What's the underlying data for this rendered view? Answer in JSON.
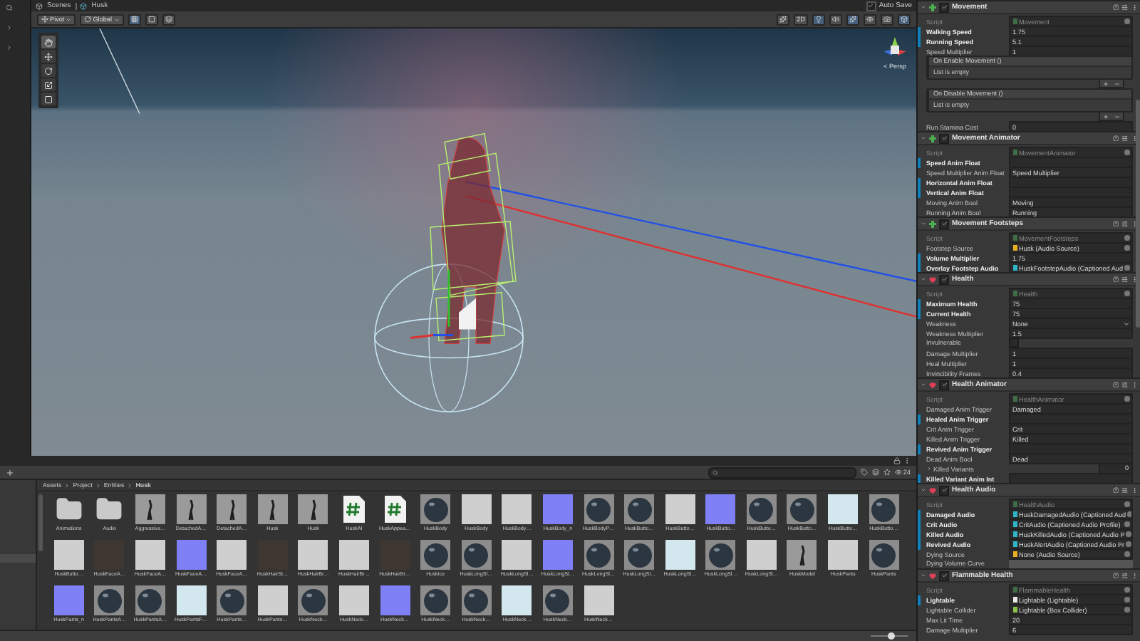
{
  "scene_header": {
    "breadcrumb": [
      "Scenes",
      "Husk"
    ],
    "auto_save": {
      "label": "Auto Save",
      "checked": true
    }
  },
  "scene_toolbar": {
    "pivot": "Pivot",
    "space": "Global",
    "mode_2d": {
      "label": "2D",
      "selected": false
    }
  },
  "scene": {
    "camera_label": "< Persp"
  },
  "project": {
    "breadcrumb": [
      "Assets",
      "Project",
      "Entities",
      "Husk"
    ],
    "hidden_count": "24",
    "zoom": {
      "level": 0.55
    },
    "assets": [
      {
        "kind": "folder",
        "label": "Animations"
      },
      {
        "kind": "folder",
        "label": "Audio"
      },
      {
        "kind": "mesh",
        "label": "Aggressive…"
      },
      {
        "kind": "mesh",
        "label": "DetachedA…"
      },
      {
        "kind": "mesh",
        "label": "DetachedA…"
      },
      {
        "kind": "mesh",
        "label": "Husk"
      },
      {
        "kind": "mesh",
        "label": "Husk"
      },
      {
        "kind": "script",
        "label": "HuskAI"
      },
      {
        "kind": "script",
        "label": "HuskAppea…"
      },
      {
        "kind": "material",
        "label": "HuskBody"
      },
      {
        "kind": "texture",
        "label": "HuskBody"
      },
      {
        "kind": "texture",
        "label": "HuskBody…"
      },
      {
        "kind": "normalmap",
        "label": "HuskBody_n"
      },
      {
        "kind": "material",
        "label": "HuskBodyP…"
      },
      {
        "kind": "material",
        "label": "HuskButto…"
      },
      {
        "kind": "texture",
        "label": "HuskButto…"
      },
      {
        "kind": "normalmap",
        "label": "HuskButto…"
      },
      {
        "kind": "material",
        "label": "HuskButto…"
      },
      {
        "kind": "material",
        "label": "HuskButto…"
      },
      {
        "kind": "icemap",
        "label": "HuskButto…"
      },
      {
        "kind": "material",
        "label": "HuskButto…"
      },
      {
        "kind": "texture",
        "label": "HuskButto…"
      },
      {
        "kind": "darkmap",
        "label": "HuskFaceA…"
      },
      {
        "kind": "texture",
        "label": "HuskFaceA…"
      },
      {
        "kind": "normalmap",
        "label": "HuskFaceA…"
      },
      {
        "kind": "texture",
        "label": "HuskFaceA…"
      },
      {
        "kind": "darkmap",
        "label": "HuskHairSt…"
      },
      {
        "kind": "texture",
        "label": "HuskHairBr…"
      },
      {
        "kind": "texture",
        "label": "HuskHairBr…"
      },
      {
        "kind": "darkmap",
        "label": "HuskHairBr…"
      },
      {
        "kind": "material",
        "label": "HuskIce"
      },
      {
        "kind": "material",
        "label": "HuskLongSl…"
      },
      {
        "kind": "texture",
        "label": "HuskLongSl…"
      },
      {
        "kind": "normalmap",
        "label": "HuskLongSl…"
      },
      {
        "kind": "material",
        "label": "HuskLongSl…"
      },
      {
        "kind": "material",
        "label": "HuskLongSl…"
      },
      {
        "kind": "icemap",
        "label": "HuskLongSl…"
      },
      {
        "kind": "material",
        "label": "HuskLongSl…"
      },
      {
        "kind": "texture",
        "label": "HuskLongSl…"
      },
      {
        "kind": "mesh",
        "label": "HuskModel"
      },
      {
        "kind": "texture",
        "label": "HuskPants"
      },
      {
        "kind": "material",
        "label": "HuskPants"
      },
      {
        "kind": "normalmap",
        "label": "HuskPants_n"
      },
      {
        "kind": "material",
        "label": "HuskPantsA…"
      },
      {
        "kind": "material",
        "label": "HuskPantsA…"
      },
      {
        "kind": "icemap",
        "label": "HuskPantsF…"
      },
      {
        "kind": "material",
        "label": "HuskPants…"
      },
      {
        "kind": "texture",
        "label": "HuskPants…"
      },
      {
        "kind": "material",
        "label": "HuskNeck…"
      },
      {
        "kind": "texture",
        "label": "HuskNeck…"
      },
      {
        "kind": "normalmap",
        "label": "HuskNeck…"
      },
      {
        "kind": "material",
        "label": "HuskNeck…"
      },
      {
        "kind": "material",
        "label": "HuskNeck…"
      },
      {
        "kind": "icemap",
        "label": "HuskNeck…"
      },
      {
        "kind": "material",
        "label": "HuskNeck…"
      },
      {
        "kind": "texture",
        "label": "HuskNeck…"
      }
    ]
  },
  "inspector": {
    "components": [
      {
        "name": "Movement",
        "color": "#4caf50",
        "enabled": true,
        "fields": [
          {
            "kind": "script",
            "label": "Script",
            "value": "Movement",
            "overridden": false
          },
          {
            "kind": "value",
            "label": "Walking Speed",
            "value": "1.75",
            "overridden": true
          },
          {
            "kind": "value",
            "label": "Running Speed",
            "value": "5.1",
            "overridden": true
          },
          {
            "kind": "value",
            "label": "Speed Multiplier",
            "value": "1",
            "overridden": false
          },
          {
            "kind": "event",
            "label": "On Enable Movement ()",
            "empty_text": "List is empty",
            "overridden": false
          },
          {
            "kind": "event",
            "label": "On Disable Movement ()",
            "empty_text": "List is empty",
            "overridden": false
          },
          {
            "kind": "value",
            "label": "Run Stamina Cost",
            "value": "0",
            "overridden": false
          }
        ]
      },
      {
        "name": "Movement Animator",
        "color": "#4caf50",
        "enabled": true,
        "fields": [
          {
            "kind": "script",
            "label": "Script",
            "value": "MovementAnimator",
            "overridden": false
          },
          {
            "kind": "value",
            "label": "Speed Anim Float",
            "overridden": true
          },
          {
            "kind": "value",
            "label": "Speed Multiplier Anim Float",
            "value": "Speed Multiplier",
            "overridden": false
          },
          {
            "kind": "value",
            "label": "Horizontal Anim Float",
            "overridden": true
          },
          {
            "kind": "value",
            "label": "Vertical Anim Float",
            "overridden": true
          },
          {
            "kind": "value",
            "label": "Moving Anim Bool",
            "value": "Moving",
            "overridden": false
          },
          {
            "kind": "value",
            "label": "Running Anim Bool",
            "value": "Running",
            "overridden": false
          }
        ]
      },
      {
        "name": "Movement Footsteps",
        "color": "#4caf50",
        "enabled": true,
        "fields": [
          {
            "kind": "script",
            "label": "Script",
            "value": "MovementFootsteps",
            "overridden": false
          },
          {
            "kind": "object",
            "label": "Footstep Source",
            "value": "Husk (Audio Source)",
            "color": "#e8b020",
            "overridden": false
          },
          {
            "kind": "value",
            "label": "Volume Multiplier",
            "value": "1.75",
            "overridden": true
          },
          {
            "kind": "object",
            "label": "Overlay Footstep Audio",
            "value": "HuskFootstepAudio (Captioned Aud",
            "color": "#2fb5c8",
            "overridden": true
          }
        ]
      },
      {
        "name": "Health",
        "color": "#e0405a",
        "enabled": true,
        "fields": [
          {
            "kind": "script",
            "label": "Script",
            "value": "Health",
            "overridden": false
          },
          {
            "kind": "value",
            "label": "Maximum Health",
            "value": "75",
            "overridden": true
          },
          {
            "kind": "value",
            "label": "Current Health",
            "value": "75",
            "overridden": true
          },
          {
            "kind": "dropdown",
            "label": "Weakness",
            "value": "None",
            "overridden": false
          },
          {
            "kind": "value",
            "label": "Weakness Multiplier",
            "value": "1.5",
            "overridden": false
          },
          {
            "kind": "checkbox",
            "label": "Invulnerable",
            "checked": false,
            "overridden": false
          },
          {
            "kind": "value",
            "label": "Damage Multiplier",
            "value": "1",
            "overridden": false
          },
          {
            "kind": "value",
            "label": "Heal Multiplier",
            "value": "1",
            "overridden": false
          },
          {
            "kind": "value",
            "label": "Invincibility Frames",
            "value": "0.4",
            "overridden": false
          }
        ]
      },
      {
        "name": "Health Animator",
        "color": "#e0405a",
        "enabled": true,
        "fields": [
          {
            "kind": "script",
            "label": "Script",
            "value": "HealthAnimator",
            "overridden": false
          },
          {
            "kind": "value",
            "label": "Damaged Anim Trigger",
            "value": "Damaged",
            "overridden": false
          },
          {
            "kind": "value",
            "label": "Healed Anim Trigger",
            "overridden": true
          },
          {
            "kind": "value",
            "label": "Crit Anim Trigger",
            "value": "Crit",
            "overridden": false
          },
          {
            "kind": "value",
            "label": "Killed Anim Trigger",
            "value": "Killed",
            "overridden": false
          },
          {
            "kind": "value",
            "label": "Revived Anim Trigger",
            "overridden": true
          },
          {
            "kind": "value",
            "label": "Dead Anim Bool",
            "value": "Dead",
            "overridden": false
          },
          {
            "kind": "foldout",
            "label": "Killed Variants",
            "value": "0",
            "expanded": false,
            "overridden": false
          },
          {
            "kind": "value",
            "label": "Killed Variant Anim Int",
            "overridden": true
          }
        ]
      },
      {
        "name": "Health Audio",
        "color": "#e0405a",
        "enabled": true,
        "fields": [
          {
            "kind": "script",
            "label": "Script",
            "value": "HealthAudio",
            "overridden": false
          },
          {
            "kind": "object",
            "label": "Damaged Audio",
            "value": "HuskDamagedAudio (Captioned Aud",
            "color": "#2fb5c8",
            "overridden": true
          },
          {
            "kind": "object",
            "label": "Crit Audio",
            "value": "CritAudio (Captioned Audio Profile)",
            "color": "#2fb5c8",
            "overridden": true
          },
          {
            "kind": "object",
            "label": "Killed Audio",
            "value": "HuskKilledAudio (Captioned Audio P",
            "color": "#2fb5c8",
            "overridden": true
          },
          {
            "kind": "object",
            "label": "Revived Audio",
            "value": "HuskAlertAudio (Captioned Audio Pr",
            "color": "#2fb5c8",
            "overridden": true
          },
          {
            "kind": "object",
            "label": "Dying Source",
            "value": "None (Audio Source)",
            "color": "#e8b020",
            "overridden": false
          },
          {
            "kind": "curve",
            "label": "Dying Volume Curve",
            "overridden": false
          }
        ]
      },
      {
        "name": "Flammable Health",
        "color": "#e0405a",
        "enabled": true,
        "fields": [
          {
            "kind": "script",
            "label": "Script",
            "value": "FlammableHealth",
            "overridden": false
          },
          {
            "kind": "object",
            "label": "Lightable",
            "value": "Lightable (Lightable)",
            "color": "#e8e8e8",
            "overridden": true
          },
          {
            "kind": "object",
            "label": "Lightable Collider",
            "value": "Lightable (Box Collider)",
            "color": "#8bc34a",
            "overridden": false
          },
          {
            "kind": "value",
            "label": "Max Lit Time",
            "value": "20",
            "overridden": false
          },
          {
            "kind": "value",
            "label": "Damage Multiplier",
            "value": "6",
            "overridden": false
          }
        ]
      }
    ]
  }
}
